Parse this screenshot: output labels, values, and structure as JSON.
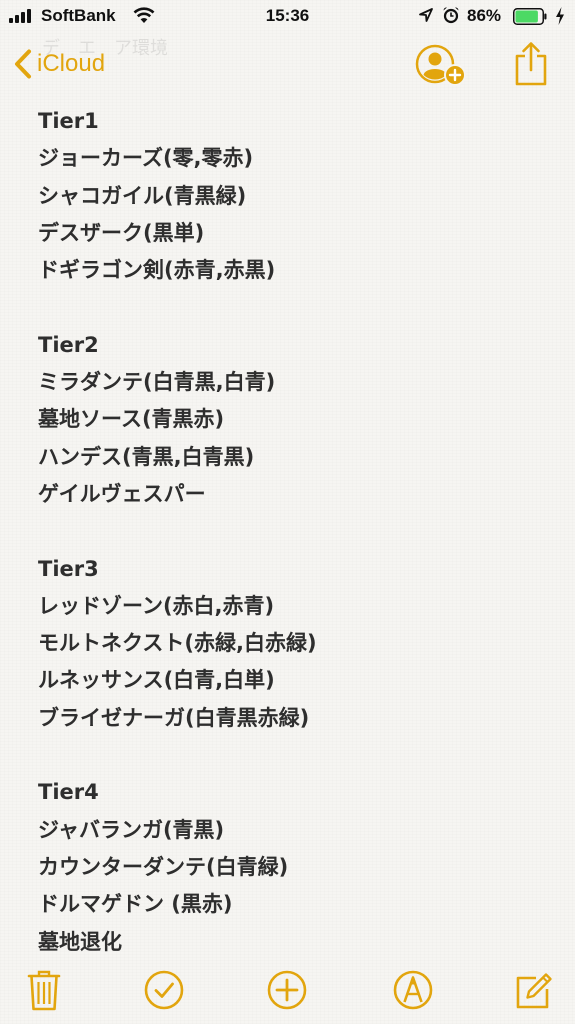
{
  "status_bar": {
    "carrier": "SoftBank",
    "time": "15:36",
    "battery_percent": "86%",
    "battery_level": 0.86,
    "icons": [
      "signal-icon",
      "wifi-icon",
      "location-arrow-icon",
      "alarm-icon",
      "battery-icon",
      "charging-icon"
    ]
  },
  "nav": {
    "back_label": "iCloud",
    "ghost_title": "デ　エ　ア環境",
    "accent_color": "#e2a50e",
    "icons": [
      "chevron-left-icon",
      "add-person-icon",
      "share-icon"
    ]
  },
  "note": {
    "lines": [
      "Tier1",
      "ジョーカーズ(零,零赤)",
      "シャコガイル(青黒緑)",
      "デスザーク(黒単)",
      "ドギラゴン剣(赤青,赤黒)",
      "",
      "Tier2",
      "ミラダンテ(白青黒,白青)",
      "墓地ソース(青黒赤)",
      "ハンデス(青黒,白青黒)",
      "ゲイルヴェスパー",
      "",
      "Tier3",
      "レッドゾーン(赤白,赤青)",
      "モルトネクスト(赤緑,白赤緑)",
      "ルネッサンス(白青,白単)",
      "ブライゼナーガ(白青黒赤緑)",
      "",
      "Tier4",
      "ジャバランガ(青黒)",
      "カウンターダンテ(白青緑)",
      "ドルマゲドン (黒赤)",
      "墓地退化"
    ]
  },
  "toolbar": {
    "icons": [
      "trash-icon",
      "checklist-icon",
      "add-icon",
      "markup-icon",
      "compose-icon"
    ]
  }
}
